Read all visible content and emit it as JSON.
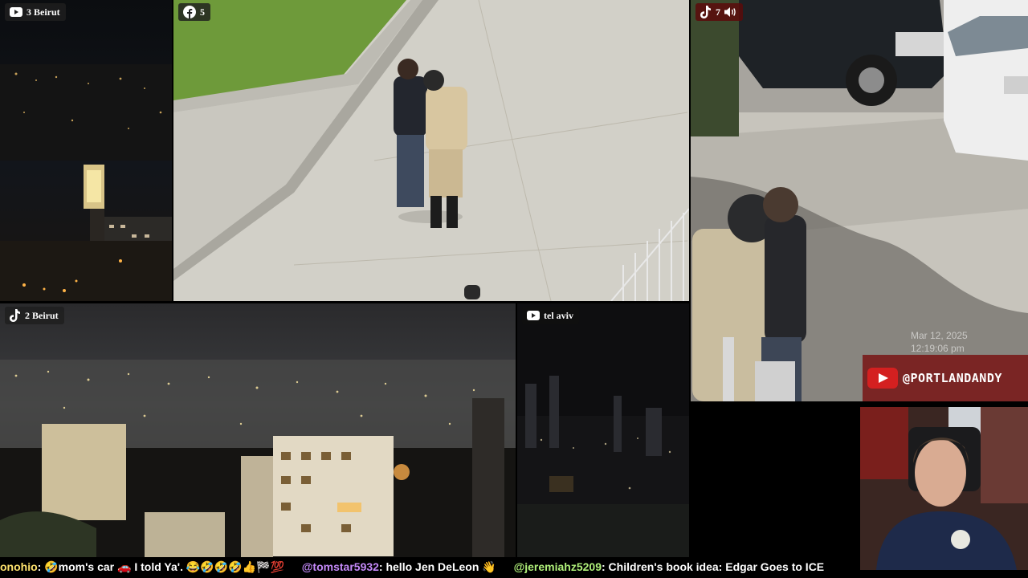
{
  "panes": {
    "beirut3": {
      "label": "3 Beirut",
      "platform_icon": "youtube-icon"
    },
    "center": {
      "label": "5",
      "platform_icon": "facebook-icon"
    },
    "portland": {
      "label": "7",
      "platform_icon": "tiktok-icon",
      "audio_icon": "speaker-icon",
      "stamp_date": "Mar 12, 2025",
      "stamp_time": "12:19:06 pm",
      "watermark_handle": "@PORTLANDANDY"
    },
    "beirut2": {
      "label": "2 Beirut",
      "platform_icon": "tiktok-icon"
    },
    "telaviv": {
      "label": "tel aviv",
      "platform_icon": "youtube-icon"
    }
  },
  "chat_ticker": [
    {
      "user": "onohio",
      "text": ": 🤣mom's car 🚗 I told Ya'. 😂🤣🤣🤣👍🏁💯"
    },
    {
      "user": "@tomstar5932",
      "text": ": hello Jen DeLeon 👋"
    },
    {
      "user": "@jeremiahz5209",
      "text": ": Children's book idea: Edgar Goes to ICE"
    }
  ],
  "colors": {
    "youtube_red": "#e62117",
    "tiktok": "#ffffff",
    "facebook": "#ffffff"
  }
}
